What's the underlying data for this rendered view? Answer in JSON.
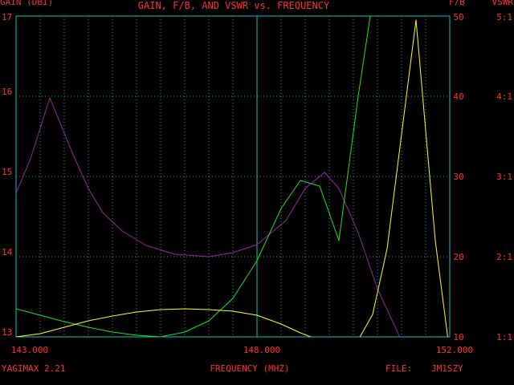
{
  "colors": {
    "background": "#000000",
    "frame": "#00c8c8",
    "grid": "#00a8a8",
    "text": "#ff3030",
    "gain_line": "#a020a0",
    "fb_line": "#20e020",
    "vswr_line": "#ffff20"
  },
  "chart_data": {
    "type": "line",
    "title": "GAIN, F/B, AND VSWR vs. FREQUENCY",
    "xlabel": "FREQUENCY (MHZ)",
    "xlim": [
      143,
      152
    ],
    "x_ticks": [
      "143.000",
      "148.000",
      "152.000"
    ],
    "left_axis": {
      "label": "GAIN (DBI)",
      "ylim": [
        13,
        17
      ],
      "ticks": [
        "13",
        "14",
        "15",
        "16",
        "17"
      ]
    },
    "right_axis_fb": {
      "label": "F/B",
      "ylim": [
        10,
        50
      ],
      "ticks": [
        "10",
        "20",
        "30",
        "40",
        "50"
      ]
    },
    "right_axis_vswr": {
      "label": "VSWR",
      "ylim": [
        1,
        5
      ],
      "ticks": [
        "1:1",
        "2:1",
        "3:1",
        "4:1",
        "5:1"
      ]
    },
    "grid": true,
    "series": [
      {
        "key": "gain",
        "axis": "gain",
        "x": [
          142.5,
          142.9,
          143.3,
          143.7,
          144.2,
          144.5,
          144.8,
          145.2,
          145.7,
          146.3,
          147.0,
          147.5,
          148.0,
          148.6,
          149.0,
          149.4,
          149.7,
          150.1,
          150.5,
          151.0
        ],
        "y": [
          14.42,
          14.65,
          15.22,
          15.98,
          15.25,
          14.85,
          14.55,
          14.32,
          14.14,
          14.03,
          14.0,
          14.05,
          14.15,
          14.45,
          14.85,
          15.05,
          14.85,
          14.3,
          13.6,
          12.95
        ]
      },
      {
        "key": "fb",
        "axis": "fb",
        "x": [
          142.5,
          143.0,
          143.5,
          144.0,
          144.5,
          145.0,
          145.5,
          146.0,
          146.5,
          147.0,
          147.5,
          148.0,
          148.5,
          148.9,
          149.3,
          149.7,
          150.1,
          150.5,
          150.9,
          151.1
        ],
        "y": [
          14.5,
          13.5,
          12.7,
          11.9,
          11.2,
          10.6,
          10.2,
          10.0,
          10.6,
          12.0,
          14.8,
          19.5,
          26.0,
          29.5,
          28.8,
          22.0,
          40.0,
          56.0,
          64.0,
          69.0
        ]
      },
      {
        "key": "vswr",
        "axis": "vswr",
        "x": [
          143.0,
          143.5,
          144.0,
          144.5,
          145.0,
          145.5,
          146.0,
          146.5,
          147.0,
          147.5,
          148.0,
          148.5,
          148.9,
          149.2,
          149.6,
          150.1,
          150.4,
          150.7,
          151.3,
          151.7,
          152.0
        ],
        "y": [
          1.0,
          1.04,
          1.12,
          1.2,
          1.26,
          1.31,
          1.34,
          1.35,
          1.34,
          1.32,
          1.27,
          1.16,
          1.05,
          0.98,
          0.95,
          0.96,
          1.28,
          2.1,
          4.95,
          2.2,
          0.8
        ]
      }
    ]
  },
  "footer": {
    "program": "YAGIMAX 2.21",
    "file_label": "FILE:",
    "file_name": "JM1SZY"
  }
}
